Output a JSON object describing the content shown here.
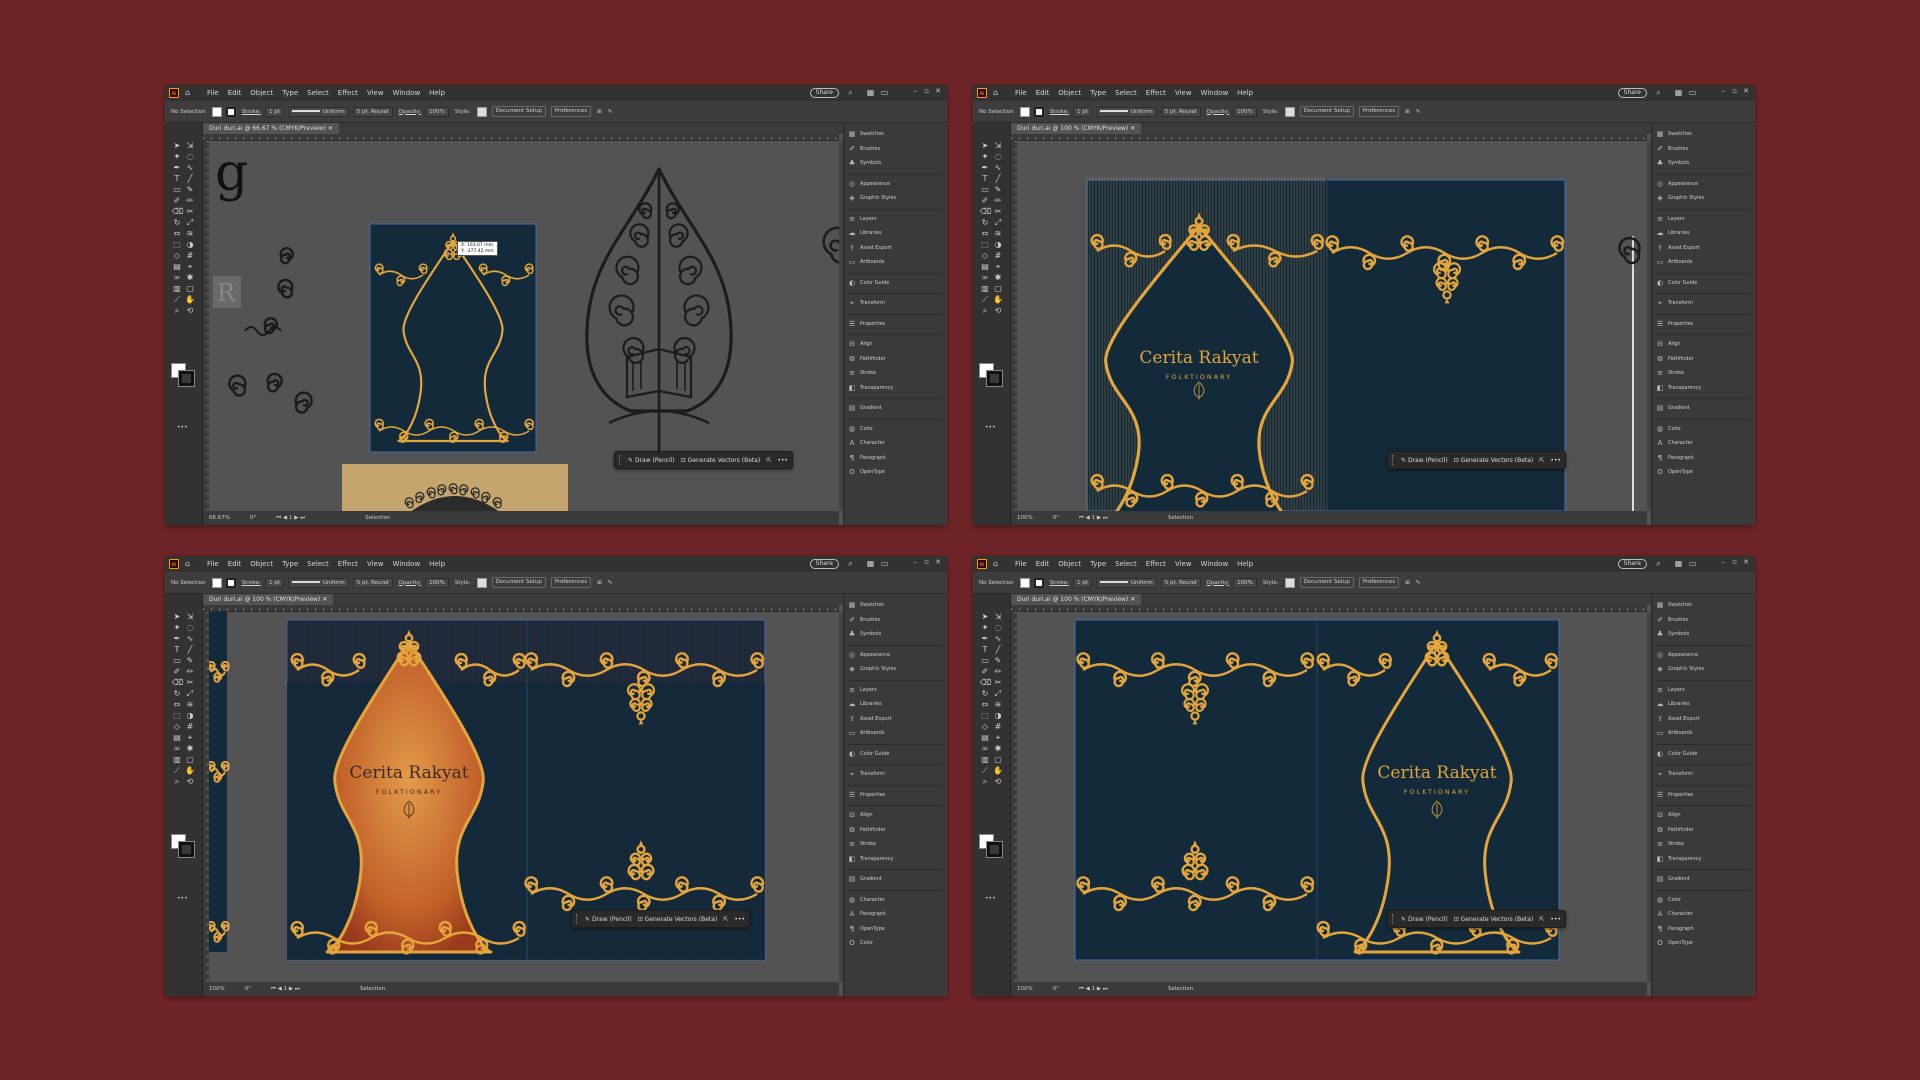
{
  "app": {
    "logo": "Ai",
    "menu": [
      "File",
      "Edit",
      "Object",
      "Type",
      "Select",
      "Effect",
      "View",
      "Window",
      "Help"
    ],
    "share": "Share"
  },
  "control": {
    "selection": "No Selection",
    "stroke_label": "Stroke:",
    "stroke_weight": "1 pt",
    "uniform": "Uniform",
    "brush": "5 pt. Round",
    "opacity_label": "Opacity:",
    "opacity": "100%",
    "style_label": "Style:",
    "doc_setup": "Document Setup",
    "preferences": "Preferences"
  },
  "panels": [
    "Swatches",
    "Brushes",
    "Symbols",
    "Appearance",
    "Graphic Styles",
    "Layers",
    "Libraries",
    "Asset Export",
    "Artboards",
    "Color Guide",
    "Transform",
    "Properties",
    "Align",
    "Pathfinder",
    "Stroke",
    "Transparency",
    "Gradient",
    "Color",
    "Character",
    "Paragraph",
    "OpenType"
  ],
  "panels_alt": [
    "Swatches",
    "Brushes",
    "Symbols",
    "Appearance",
    "Graphic Styles",
    "Layers",
    "Libraries",
    "Asset Export",
    "Artboards",
    "Color Guide",
    "Transform",
    "Properties",
    "Align",
    "Pathfinder",
    "Stroke",
    "Transparency",
    "Gradient",
    "Character",
    "Paragraph",
    "OpenType",
    "Color"
  ],
  "context_bar": {
    "draw": "Draw (Pencil)",
    "generate": "Generate Vectors (Beta)",
    "more": "•••"
  },
  "windows": [
    {
      "tab": "Duri duri.ai @ 66.67 % (CMYK/Preview)",
      "zoom": "66.67%",
      "angle": "0°",
      "page": "1",
      "mode": "Selection"
    },
    {
      "tab": "Duri duri.ai @ 100 % (CMYK/Preview)",
      "zoom": "100%",
      "angle": "0°",
      "page": "1",
      "mode": "Selection"
    },
    {
      "tab": "Duri duri.ai @ 100 % (CMYK/Preview)",
      "zoom": "100%",
      "angle": "0°",
      "page": "1",
      "mode": "Selection"
    },
    {
      "tab": "Duri duri.ai @ 100 % (CMYK/Preview)",
      "zoom": "100%",
      "angle": "0°",
      "page": "1",
      "mode": "Selection"
    }
  ],
  "canvas1": {
    "glyph": "g",
    "tooltip_x": "X: 163.07 mm",
    "tooltip_y": "Y: -177.42 mm"
  },
  "cover": {
    "title": "Cerita Rakyat",
    "subtitle": "FOLKTIONARY"
  },
  "colors": {
    "background": "#6e2426",
    "navy": "#122a3a",
    "gold": "#e3a53c",
    "ui_dark": "#323232",
    "canvas": "#535353"
  }
}
